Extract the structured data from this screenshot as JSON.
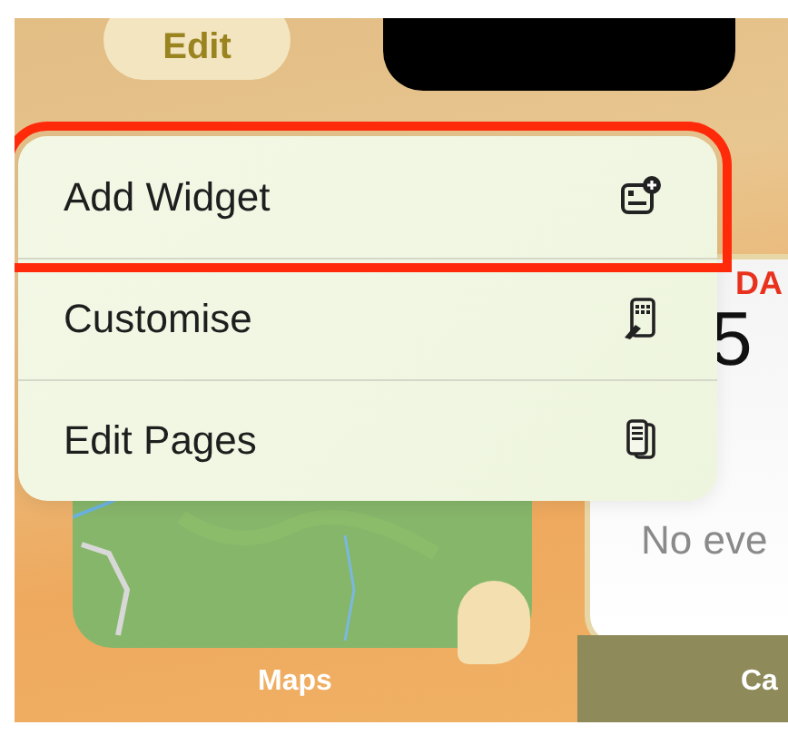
{
  "edit_button": {
    "label": "Edit"
  },
  "calendar_widget": {
    "day_label": "DA",
    "date": "5",
    "note": "No eve"
  },
  "context_menu": {
    "items": [
      {
        "label": "Add Widget",
        "kind": "add-widget",
        "highlighted": true
      },
      {
        "label": "Customise",
        "kind": "customise",
        "highlighted": false
      },
      {
        "label": "Edit Pages",
        "kind": "edit-pages",
        "highlighted": false
      }
    ]
  },
  "app_labels": [
    {
      "label": "Maps"
    },
    {
      "label": "Ca"
    }
  ]
}
